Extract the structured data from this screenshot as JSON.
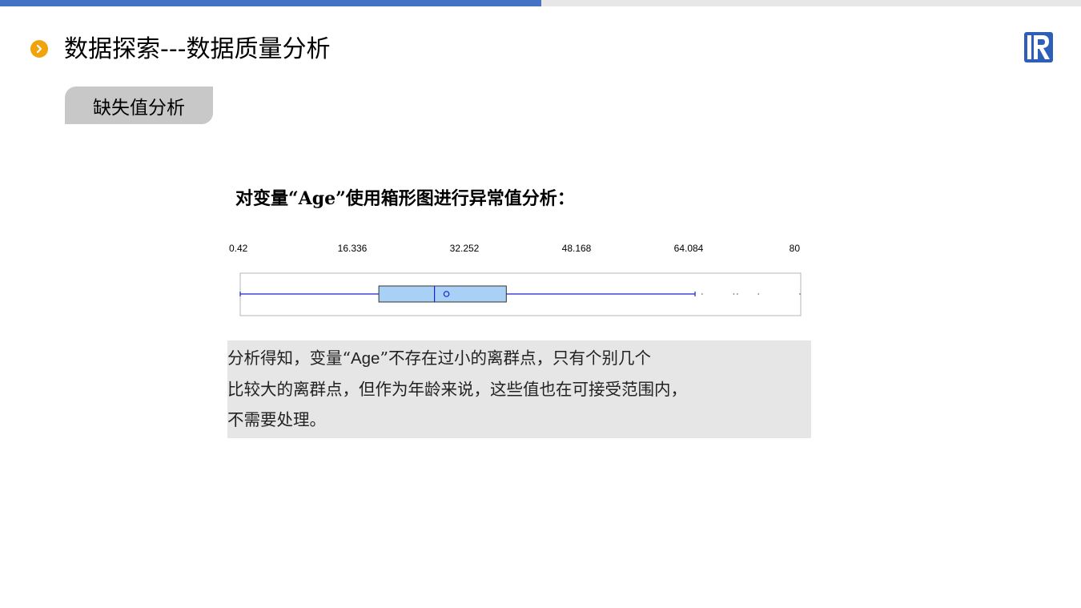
{
  "header": {
    "title": "数据探索---数据质量分析",
    "colors": {
      "accent_blue": "#4472c4",
      "icon_orange": "#f0a30a"
    },
    "logo_icon": "raqsoft-logo-icon",
    "title_icon": "chevron-right-circle-icon"
  },
  "section": {
    "badge_label": "缺失值分析"
  },
  "chart_heading": "对变量“Age”使用箱形图进行异常值分析：",
  "chart_data": {
    "type": "boxplot",
    "orientation": "horizontal",
    "tick_labels": [
      "0.42",
      "16.336",
      "32.252",
      "48.168",
      "64.084",
      "80"
    ],
    "xlim": [
      0.42,
      80
    ],
    "whisker_low": 0.42,
    "q1": 20.1,
    "median": 28.0,
    "mean": 29.7,
    "q3": 38.2,
    "whisker_high": 65.0,
    "outliers": [
      66.0,
      70.5,
      71.0,
      74.0,
      80.0
    ],
    "colors": {
      "box_fill": "#a9d1f5",
      "lines": "#1f1fd6",
      "frame": "#b0b0b0"
    }
  },
  "note": {
    "line1_pre": "分析得知，变量“",
    "line1_var": "Age",
    "line1_post": "”不存在过小的离群点，只有个别几个",
    "line2": "比较大的离群点，但作为年龄来说，这些值也在可接受范围内，",
    "line3": "不需要处理。"
  }
}
